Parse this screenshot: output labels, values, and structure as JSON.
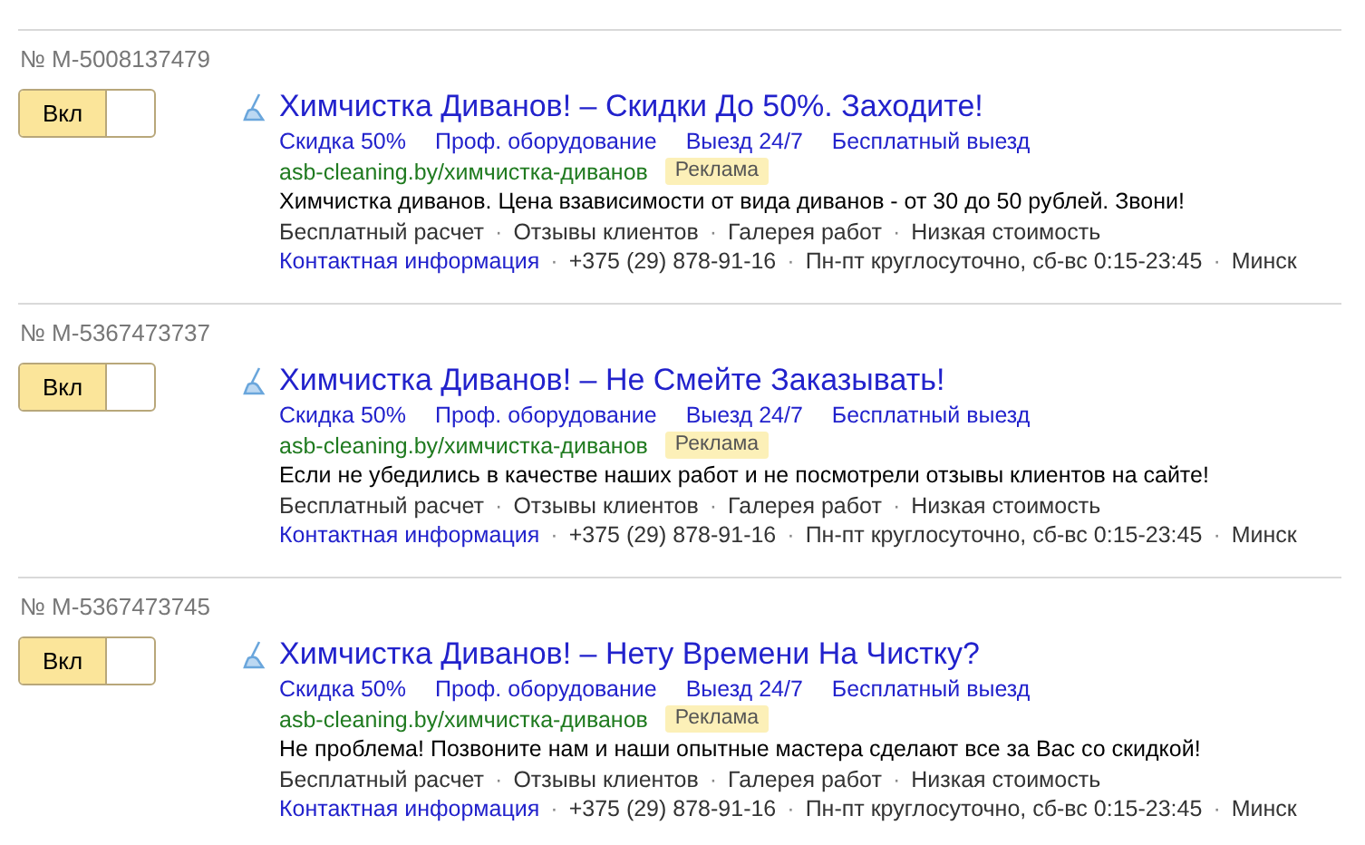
{
  "separator": "·",
  "ads": [
    {
      "number": "№ M-5008137479",
      "toggle": {
        "label": "Вкл",
        "on": true
      },
      "title": "Химчистка Диванов! – Скидки До 50%. Заходите!",
      "sitelinks": [
        "Скидка 50%",
        "Проф. оборудование",
        "Выезд 24/7",
        "Бесплатный выезд"
      ],
      "url": "asb-cleaning.by/химчистка-диванов",
      "badge": "Реклама",
      "text": "Химчистка диванов. Цена взависимости от вида диванов - от 30 до 50 рублей. Звони!",
      "features": [
        "Бесплатный расчет",
        "Отзывы клиентов",
        "Галерея работ",
        "Низкая стоимость"
      ],
      "contact_link": "Контактная информация",
      "contacts": [
        "+375 (29) 878-91-16",
        "Пн-пт круглосуточно, сб-вс 0:15-23:45",
        "Минск"
      ]
    },
    {
      "number": "№ M-5367473737",
      "toggle": {
        "label": "Вкл",
        "on": true
      },
      "title": "Химчистка Диванов! – Не Смейте Заказывать!",
      "sitelinks": [
        "Скидка 50%",
        "Проф. оборудование",
        "Выезд 24/7",
        "Бесплатный выезд"
      ],
      "url": "asb-cleaning.by/химчистка-диванов",
      "badge": "Реклама",
      "text": "Если не убедились в качестве наших работ и не посмотрели отзывы клиентов на сайте!",
      "features": [
        "Бесплатный расчет",
        "Отзывы клиентов",
        "Галерея работ",
        "Низкая стоимость"
      ],
      "contact_link": "Контактная информация",
      "contacts": [
        "+375 (29) 878-91-16",
        "Пн-пт круглосуточно, сб-вс 0:15-23:45",
        "Минск"
      ]
    },
    {
      "number": "№ M-5367473745",
      "toggle": {
        "label": "Вкл",
        "on": true
      },
      "title": "Химчистка Диванов! – Нету Времени На Чистку?",
      "sitelinks": [
        "Скидка 50%",
        "Проф. оборудование",
        "Выезд 24/7",
        "Бесплатный выезд"
      ],
      "url": "asb-cleaning.by/химчистка-диванов",
      "badge": "Реклама",
      "text": "Не проблема! Позвоните нам и наши опытные мастера сделают все за Вас со скидкой!",
      "features": [
        "Бесплатный расчет",
        "Отзывы клиентов",
        "Галерея работ",
        "Низкая стоимость"
      ],
      "contact_link": "Контактная информация",
      "contacts": [
        "+375 (29) 878-91-16",
        "Пн-пт круглосуточно, сб-вс 0:15-23:45",
        "Минск"
      ]
    }
  ]
}
